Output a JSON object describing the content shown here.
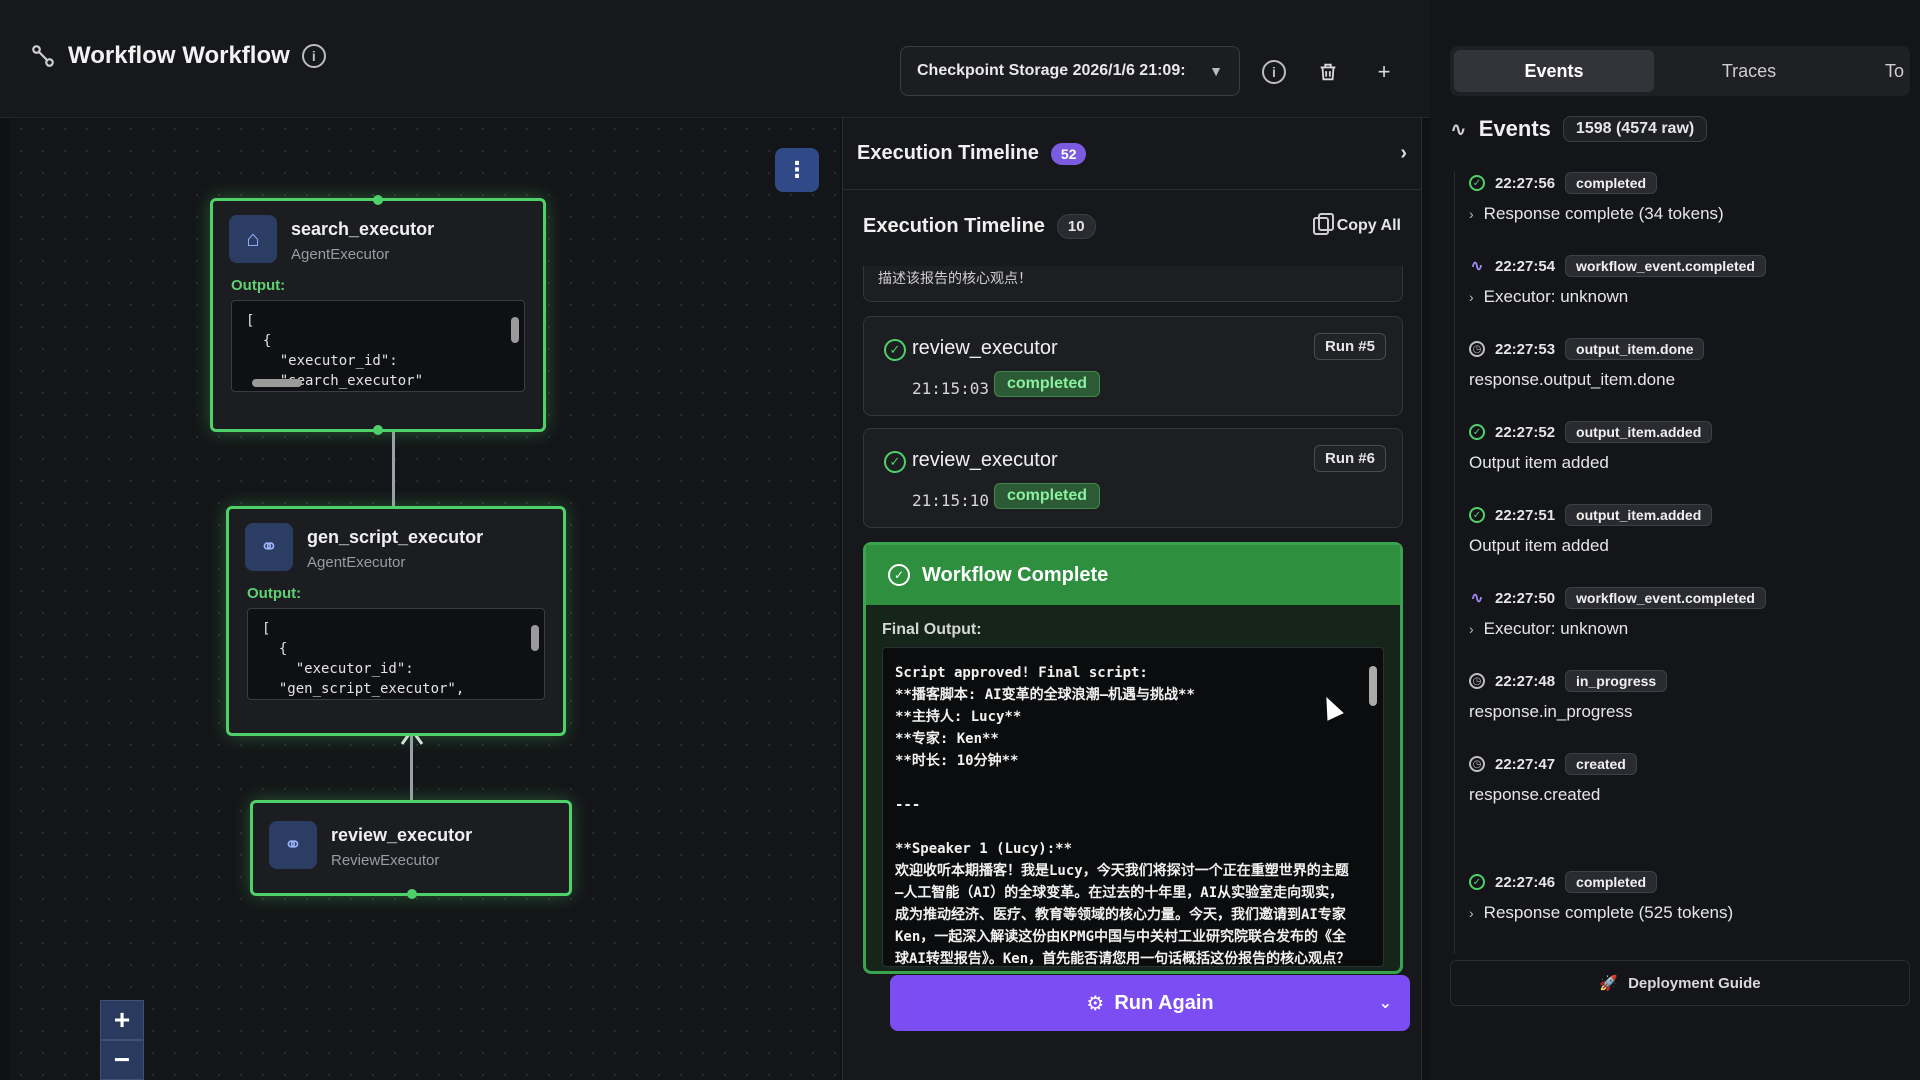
{
  "header": {
    "title": "Workflow Workflow",
    "checkpoint_label": "Checkpoint Storage 2026/1/6 21:09:"
  },
  "canvas": {
    "nodes": [
      {
        "name": "search_executor",
        "type": "AgentExecutor",
        "output_label": "Output:",
        "output_preview": "[\n  {\n    \"executor_id\":\n    \"search_executor\""
      },
      {
        "name": "gen_script_executor",
        "type": "AgentExecutor",
        "output_label": "Output:",
        "output_preview": "[\n  {\n    \"executor_id\":\n  \"gen_script_executor\","
      },
      {
        "name": "review_executor",
        "type": "ReviewExecutor"
      }
    ],
    "zoom_in": "+",
    "zoom_out": "−"
  },
  "timeline": {
    "outer_title": "Execution Timeline",
    "outer_count": "52",
    "inner_title": "Execution Timeline",
    "inner_count": "10",
    "copy_all": "Copy All",
    "previous_snippet": "描述该报告的核心观点！",
    "runs": [
      {
        "name": "review_executor",
        "time": "21:15:03",
        "status": "completed",
        "run": "Run #5"
      },
      {
        "name": "review_executor",
        "time": "21:15:10",
        "status": "completed",
        "run": "Run #6"
      }
    ],
    "complete": {
      "title": "Workflow Complete",
      "final_label": "Final Output:",
      "final_text": "Script approved! Final script:\n**播客脚本: AI变革的全球浪潮—机遇与挑战**\n**主持人: Lucy**\n**专家: Ken**\n**时长: 10分钟**\n\n---\n\n**Speaker 1 (Lucy):**\n欢迎收听本期播客！我是Lucy，今天我们将探讨一个正在重塑世界的主题—人工智能（AI）的全球变革。在过去的十年里，AI从实验室走向现实，成为推动经济、医疗、教育等领域的核心力量。今天，我们邀请到AI专家Ken，一起深入解读这份由KPMG中国与中关村工业研究院联合发布的《全球AI转型报告》。Ken，首先能否请您用一句话概括这份报告的核心观点？"
    },
    "run_again": "Run Again"
  },
  "events": {
    "tabs": [
      "Events",
      "Traces",
      "To"
    ],
    "title": "Events",
    "count": "1598 (4574 raw)",
    "items": [
      {
        "time": "22:27:56",
        "tag": "completed",
        "desc": "Response complete (34 tokens)",
        "icon": "check-circle-icon",
        "expandable": true
      },
      {
        "time": "22:27:54",
        "tag": "workflow_event.completed",
        "desc": "Executor: unknown",
        "icon": "activity-icon",
        "expandable": true
      },
      {
        "time": "22:27:53",
        "tag": "output_item.done",
        "desc": "response.output_item.done",
        "icon": "clock-icon",
        "expandable": false
      },
      {
        "time": "22:27:52",
        "tag": "output_item.added",
        "desc": "Output item added",
        "icon": "check-circle-icon",
        "expandable": false
      },
      {
        "time": "22:27:51",
        "tag": "output_item.added",
        "desc": "Output item added",
        "icon": "check-circle-icon",
        "expandable": false
      },
      {
        "time": "22:27:50",
        "tag": "workflow_event.completed",
        "desc": "Executor: unknown",
        "icon": "activity-icon",
        "expandable": true
      },
      {
        "time": "22:27:48",
        "tag": "in_progress",
        "desc": "response.in_progress",
        "icon": "clock-icon",
        "expandable": false
      },
      {
        "time": "22:27:47",
        "tag": "created",
        "desc": "response.created",
        "icon": "clock-icon",
        "expandable": false
      },
      {
        "time": "22:27:46",
        "tag": "completed",
        "desc": "Response complete (525 tokens)",
        "icon": "check-circle-icon",
        "expandable": true
      }
    ],
    "deploy": "Deployment Guide"
  },
  "colors": {
    "accent_green": "#4fd16a",
    "accent_purple": "#7b4df2",
    "panel_bg": "#17181b"
  }
}
